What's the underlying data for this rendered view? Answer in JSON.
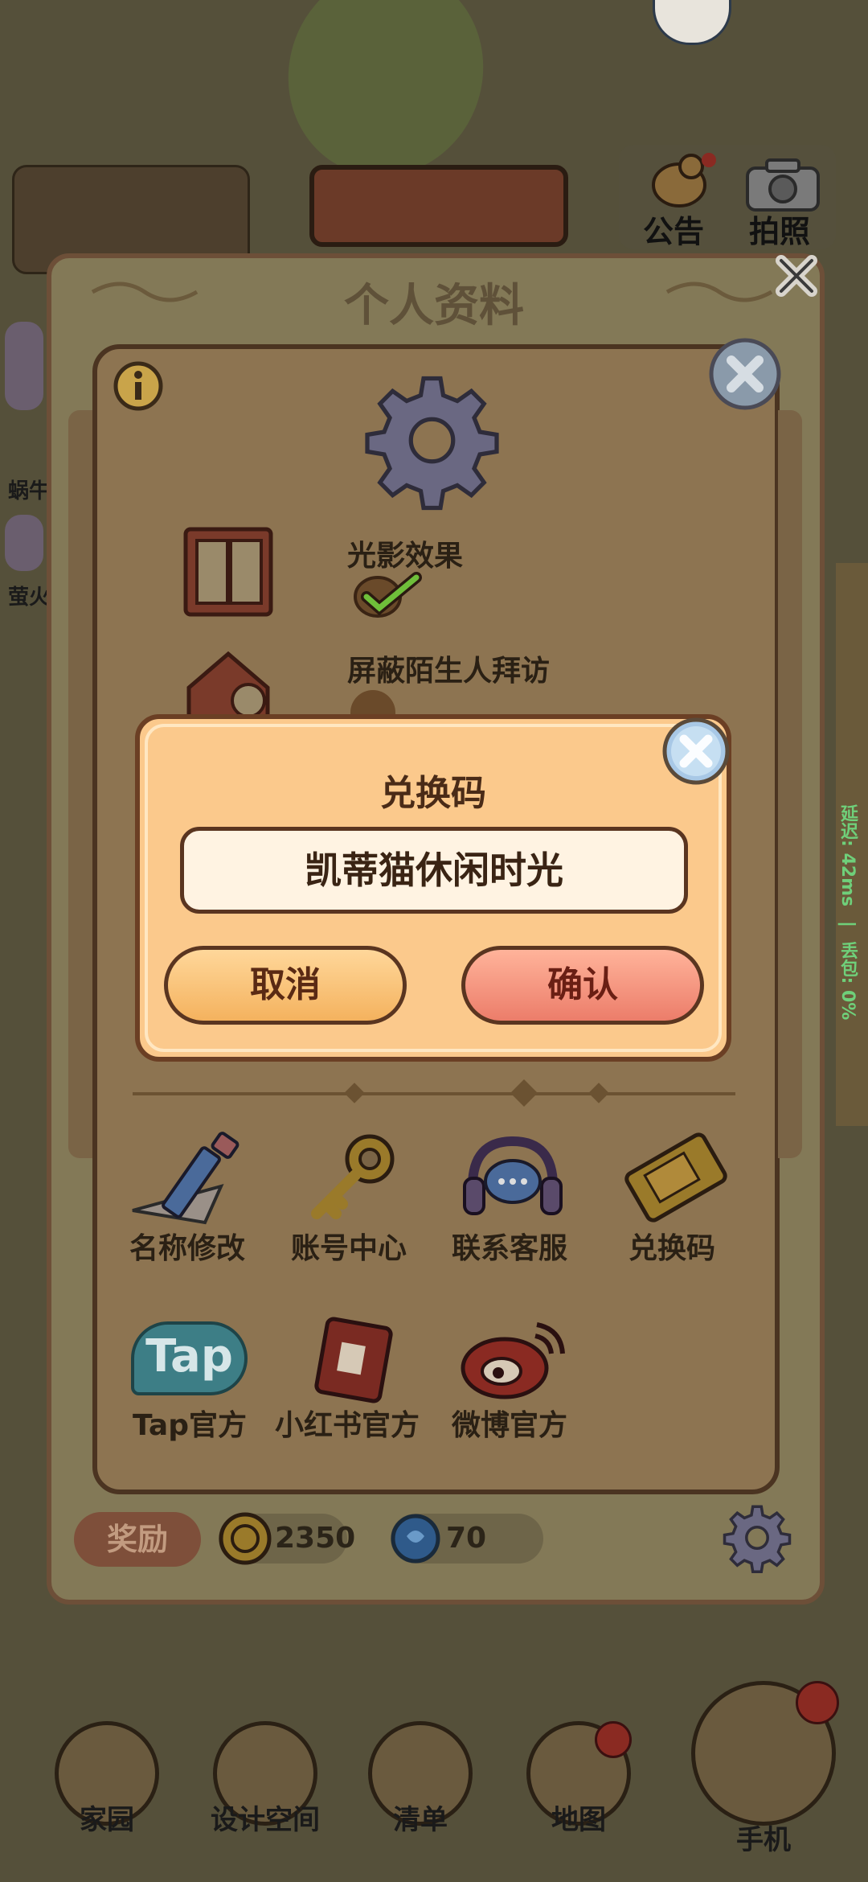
{
  "top_buttons": {
    "notice": "公告",
    "photo": "拍照"
  },
  "profile_panel": {
    "title": "个人资料",
    "reward_label": "奖励",
    "coins": "2350",
    "gems": "70"
  },
  "settings": {
    "options": [
      {
        "label": "光影效果",
        "checked": true
      },
      {
        "label": "屏蔽陌生人拜访",
        "checked": false
      }
    ],
    "actions": [
      {
        "label": "名称修改",
        "icon": "pencil-icon"
      },
      {
        "label": "账号中心",
        "icon": "key-icon"
      },
      {
        "label": "联系客服",
        "icon": "headset-icon"
      },
      {
        "label": "兑换码",
        "icon": "ticket-icon"
      },
      {
        "label": "Tap官方",
        "icon": "tap-logo-icon"
      },
      {
        "label": "小红书官方",
        "icon": "red-book-icon"
      },
      {
        "label": "微博官方",
        "icon": "weibo-icon"
      }
    ]
  },
  "dialog": {
    "title": "兑换码",
    "code_value": "凯蒂猫休闲时光",
    "cancel_label": "取消",
    "confirm_label": "确认"
  },
  "side_left": [
    "蜗牛",
    "萤火"
  ],
  "tap_logo_text": "Tap",
  "latency": {
    "ping": "延迟: 42ms",
    "loss": "丢包: 0%"
  },
  "nav": [
    {
      "label": "家园",
      "icon": "home-icon"
    },
    {
      "label": "设计空间",
      "icon": "design-icon"
    },
    {
      "label": "清单",
      "icon": "list-icon"
    },
    {
      "label": "地图",
      "icon": "map-pin-icon"
    },
    {
      "label": "手机",
      "icon": "phone-icon"
    }
  ],
  "colors": {
    "dialog_bg": "#fbc98c",
    "confirm": "#ec7d6a",
    "cancel": "#f4b25e",
    "check": "#6fbf3a"
  }
}
